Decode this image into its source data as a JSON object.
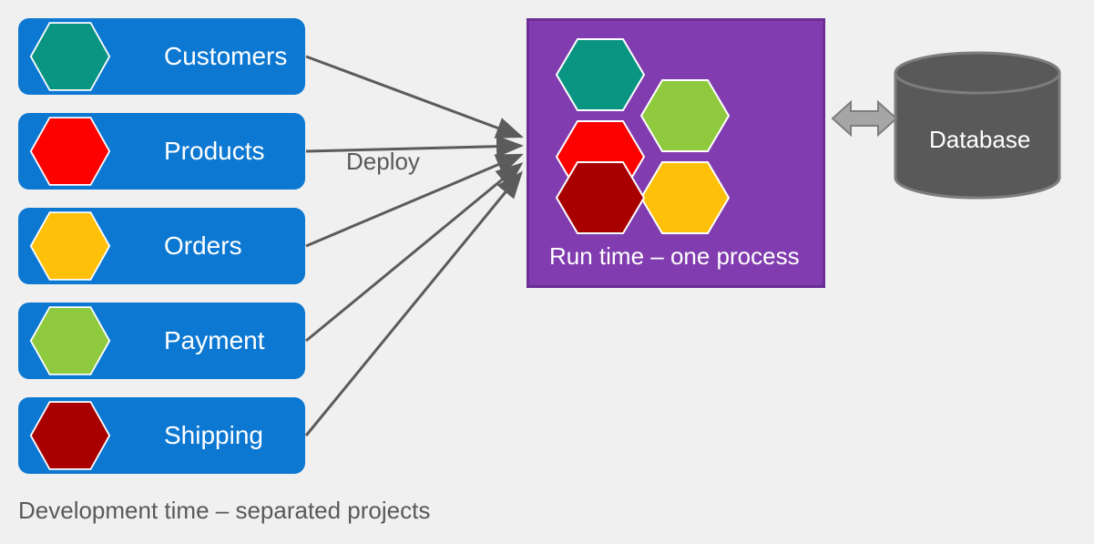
{
  "modules": [
    {
      "label": "Customers",
      "color": "#0a9482"
    },
    {
      "label": "Products",
      "color": "#fd0000"
    },
    {
      "label": "Orders",
      "color": "#fec008"
    },
    {
      "label": "Payment",
      "color": "#8fc93e"
    },
    {
      "label": "Shipping",
      "color": "#a80000"
    }
  ],
  "runtime_label": "Run time – one process",
  "deploy_label": "Deploy",
  "dev_caption": "Development time – separated projects",
  "database_label": "Database",
  "colors": {
    "module_bg": "#0d78d2",
    "runtime_bg": "#813daf",
    "runtime_border": "#6b2e96",
    "arrow": "#5b5b5b",
    "db_fill": "#595959",
    "db_stroke": "#7d7d7d"
  }
}
